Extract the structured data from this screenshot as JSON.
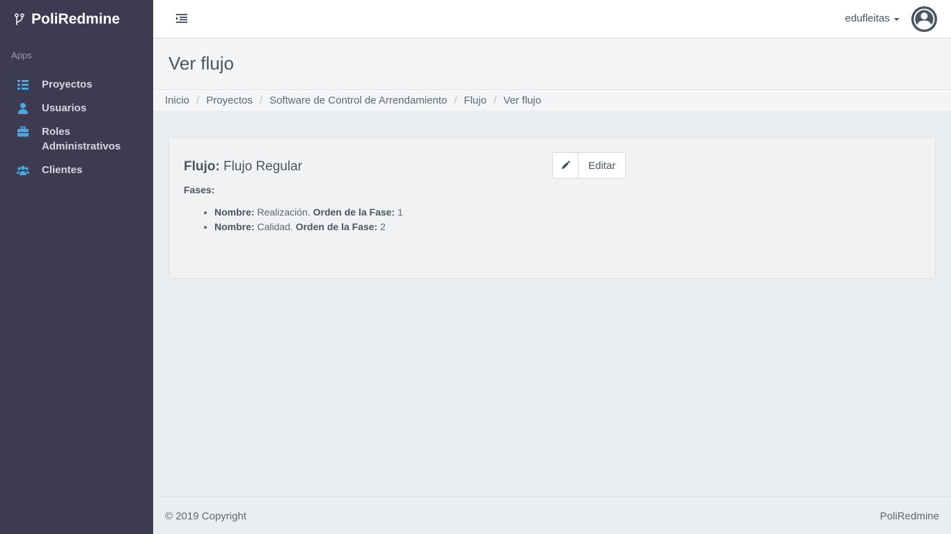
{
  "brand": {
    "name": "PoliRedmine",
    "icon": "branch-icon"
  },
  "sidebar": {
    "section_label": "Apps",
    "items": [
      {
        "label": "Proyectos",
        "icon": "list-icon"
      },
      {
        "label": "Usuarios",
        "icon": "user-icon"
      },
      {
        "label": "Roles Administrativos",
        "icon": "briefcase-icon"
      },
      {
        "label": "Clientes",
        "icon": "users-icon"
      }
    ]
  },
  "topbar": {
    "username": "edufleitas",
    "toggle_icon": "menu-toggle-icon",
    "avatar_icon": "user-circle-icon"
  },
  "page": {
    "title": "Ver flujo"
  },
  "breadcrumb": [
    "Inicio",
    "Proyectos",
    "Software de Control de Arrendamiento",
    "Flujo",
    "Ver flujo"
  ],
  "flow": {
    "label": "Flujo:",
    "name": "Flujo Regular",
    "edit_label": "Editar",
    "edit_icon": "pencil-icon",
    "phases_label": "Fases:",
    "phases": [
      {
        "name_label": "Nombre:",
        "name": "Realización.",
        "order_label": "Orden de la Fase:",
        "order": "1"
      },
      {
        "name_label": "Nombre:",
        "name": "Calidad.",
        "order_label": "Orden de la Fase:",
        "order": "2"
      }
    ]
  },
  "footer": {
    "copyright": "© 2019 Copyright",
    "brand": "PoliRedmine"
  },
  "colors": {
    "sidebar_bg": "#3d3b51",
    "icon_accent": "#4aa8e0",
    "content_bg": "#ebeef1"
  }
}
